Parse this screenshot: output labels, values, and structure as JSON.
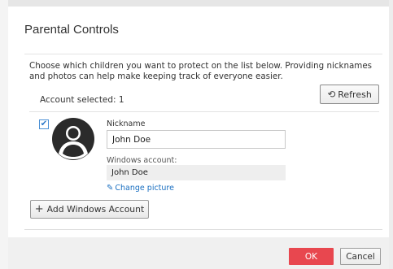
{
  "dialog": {
    "title": "Parental Controls",
    "intro": "Choose which children you want to protect on the list below. Providing nicknames and photos can help make keeping track of everyone easier.",
    "account_selected": "Account selected: 1",
    "refresh_label": "Refresh",
    "refresh_icon": "refresh-icon"
  },
  "account": {
    "checked": true,
    "avatar_icon": "user-silhouette-icon",
    "nickname_label": "Nickname",
    "nickname_value": "John Doe",
    "windows_account_label": "Windows account:",
    "windows_account_value": "John Doe",
    "change_picture_label": "Change picture",
    "change_picture_icon": "pencil-icon"
  },
  "add_button": {
    "label": "Add Windows Account",
    "icon": "plus-icon"
  },
  "footer": {
    "ok_label": "OK",
    "cancel_label": "Cancel"
  },
  "colors": {
    "ok_button": "#e8474f",
    "link": "#1a6fc1",
    "checkbox": "#2a78c8"
  }
}
